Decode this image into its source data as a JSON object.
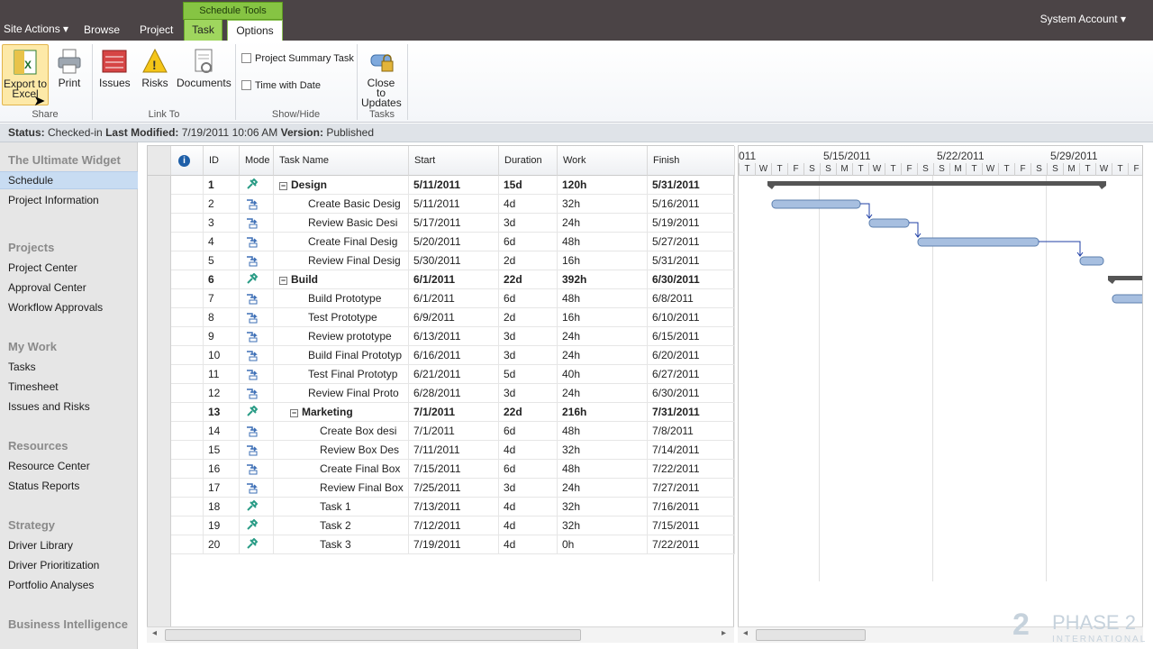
{
  "topbar": {
    "site_actions": "Site Actions",
    "browse": "Browse",
    "project": "Project",
    "contextual_group": "Schedule Tools",
    "tab_task": "Task",
    "tab_options": "Options",
    "account": "System Account"
  },
  "ribbon": {
    "export": "Export to Excel",
    "print": "Print",
    "group_share": "Share",
    "issues": "Issues",
    "risks": "Risks",
    "documents": "Documents",
    "group_linkto": "Link To",
    "project_summary_task": "Project Summary Task",
    "time_with_date": "Time with Date",
    "group_showhide": "Show/Hide",
    "close_to_updates": "Close to Updates",
    "group_tasks": "Tasks"
  },
  "status": {
    "status_label": "Status:",
    "status_value": "Checked-in",
    "modified_label": "Last Modified:",
    "modified_value": "7/19/2011 10:06 AM",
    "version_label": "Version:",
    "version_value": "Published"
  },
  "nav": {
    "site_title": "The Ultimate Widget",
    "schedule": "Schedule",
    "project_information": "Project Information",
    "projects": "Projects",
    "project_center": "Project Center",
    "approval_center": "Approval Center",
    "workflow_approvals": "Workflow Approvals",
    "my_work": "My Work",
    "tasks": "Tasks",
    "timesheet": "Timesheet",
    "issues_risks": "Issues and Risks",
    "resources": "Resources",
    "resource_center": "Resource Center",
    "status_reports": "Status Reports",
    "strategy": "Strategy",
    "driver_library": "Driver Library",
    "driver_prioritization": "Driver Prioritization",
    "portfolio_analyses": "Portfolio Analyses",
    "business_intelligence": "Business Intelligence"
  },
  "columns": {
    "id": "ID",
    "mode": "Mode",
    "task_name": "Task Name",
    "start": "Start",
    "duration": "Duration",
    "work": "Work",
    "finish": "Finish"
  },
  "rows": [
    {
      "id": "1",
      "name": "Design",
      "start": "5/11/2011",
      "dur": "15d",
      "work": "120h",
      "finish": "5/31/2011",
      "summary": true,
      "level": 0
    },
    {
      "id": "2",
      "name": "Create Basic Desig",
      "start": "5/11/2011",
      "dur": "4d",
      "work": "32h",
      "finish": "5/16/2011",
      "summary": false,
      "level": 1
    },
    {
      "id": "3",
      "name": "Review Basic Desi",
      "start": "5/17/2011",
      "dur": "3d",
      "work": "24h",
      "finish": "5/19/2011",
      "summary": false,
      "level": 1
    },
    {
      "id": "4",
      "name": "Create Final Desig",
      "start": "5/20/2011",
      "dur": "6d",
      "work": "48h",
      "finish": "5/27/2011",
      "summary": false,
      "level": 1
    },
    {
      "id": "5",
      "name": "Review Final Desig",
      "start": "5/30/2011",
      "dur": "2d",
      "work": "16h",
      "finish": "5/31/2011",
      "summary": false,
      "level": 1
    },
    {
      "id": "6",
      "name": "Build",
      "start": "6/1/2011",
      "dur": "22d",
      "work": "392h",
      "finish": "6/30/2011",
      "summary": true,
      "level": 0
    },
    {
      "id": "7",
      "name": "Build Prototype",
      "start": "6/1/2011",
      "dur": "6d",
      "work": "48h",
      "finish": "6/8/2011",
      "summary": false,
      "level": 1
    },
    {
      "id": "8",
      "name": "Test Prototype",
      "start": "6/9/2011",
      "dur": "2d",
      "work": "16h",
      "finish": "6/10/2011",
      "summary": false,
      "level": 1
    },
    {
      "id": "9",
      "name": "Review prototype",
      "start": "6/13/2011",
      "dur": "3d",
      "work": "24h",
      "finish": "6/15/2011",
      "summary": false,
      "level": 1
    },
    {
      "id": "10",
      "name": "Build Final Prototyp",
      "start": "6/16/2011",
      "dur": "3d",
      "work": "24h",
      "finish": "6/20/2011",
      "summary": false,
      "level": 1
    },
    {
      "id": "11",
      "name": "Test Final Prototyp",
      "start": "6/21/2011",
      "dur": "5d",
      "work": "40h",
      "finish": "6/27/2011",
      "summary": false,
      "level": 1
    },
    {
      "id": "12",
      "name": "Review Final Proto",
      "start": "6/28/2011",
      "dur": "3d",
      "work": "24h",
      "finish": "6/30/2011",
      "summary": false,
      "level": 1
    },
    {
      "id": "13",
      "name": "Marketing",
      "start": "7/1/2011",
      "dur": "22d",
      "work": "216h",
      "finish": "7/31/2011",
      "summary": true,
      "level": 1
    },
    {
      "id": "14",
      "name": "Create Box desi",
      "start": "7/1/2011",
      "dur": "6d",
      "work": "48h",
      "finish": "7/8/2011",
      "summary": false,
      "level": 2
    },
    {
      "id": "15",
      "name": "Review Box Des",
      "start": "7/11/2011",
      "dur": "4d",
      "work": "32h",
      "finish": "7/14/2011",
      "summary": false,
      "level": 2
    },
    {
      "id": "16",
      "name": "Create Final Box",
      "start": "7/15/2011",
      "dur": "6d",
      "work": "48h",
      "finish": "7/22/2011",
      "summary": false,
      "level": 2
    },
    {
      "id": "17",
      "name": "Review Final Box",
      "start": "7/25/2011",
      "dur": "3d",
      "work": "24h",
      "finish": "7/27/2011",
      "summary": false,
      "level": 2
    },
    {
      "id": "18",
      "name": "Task 1",
      "start": "7/13/2011",
      "dur": "4d",
      "work": "32h",
      "finish": "7/16/2011",
      "summary": false,
      "level": 2,
      "manual": true
    },
    {
      "id": "19",
      "name": "Task 2",
      "start": "7/12/2011",
      "dur": "4d",
      "work": "32h",
      "finish": "7/15/2011",
      "summary": false,
      "level": 2,
      "manual": true
    },
    {
      "id": "20",
      "name": "Task 3",
      "start": "7/19/2011",
      "dur": "4d",
      "work": "0h",
      "finish": "7/22/2011",
      "summary": false,
      "level": 2,
      "manual": true
    }
  ],
  "gantt": {
    "weeks": [
      "011",
      "5/15/2011",
      "5/22/2011",
      "5/29/2011"
    ],
    "days": [
      "T",
      "W",
      "T",
      "F",
      "S",
      "S",
      "M",
      "T",
      "W",
      "T",
      "F",
      "S",
      "S",
      "M",
      "T",
      "W",
      "T",
      "F",
      "S",
      "S",
      "M",
      "T",
      "W",
      "T",
      "F"
    ]
  },
  "logo": {
    "text": "PHASE 2",
    "sub": "INTERNATIONAL"
  }
}
